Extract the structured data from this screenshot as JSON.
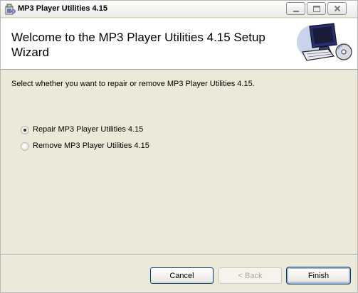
{
  "window": {
    "title": "MP3 Player Utilities 4.15"
  },
  "header": {
    "title": "Welcome to the MP3 Player Utilities 4.15 Setup Wizard"
  },
  "main": {
    "instruction": "Select whether you want to repair or remove MP3 Player Utilities 4.15.",
    "options": [
      {
        "label": "Repair MP3 Player Utilities 4.15",
        "selected": true
      },
      {
        "label": "Remove MP3 Player Utilities 4.15",
        "selected": false
      }
    ]
  },
  "footer": {
    "cancel_label": "Cancel",
    "back_label": "< Back",
    "finish_label": "Finish"
  },
  "icons": {
    "app": "installer-icon",
    "minimize": "minimize-icon",
    "maximize": "maximize-icon",
    "close": "close-icon",
    "header_art": "computer-cd-icon"
  }
}
